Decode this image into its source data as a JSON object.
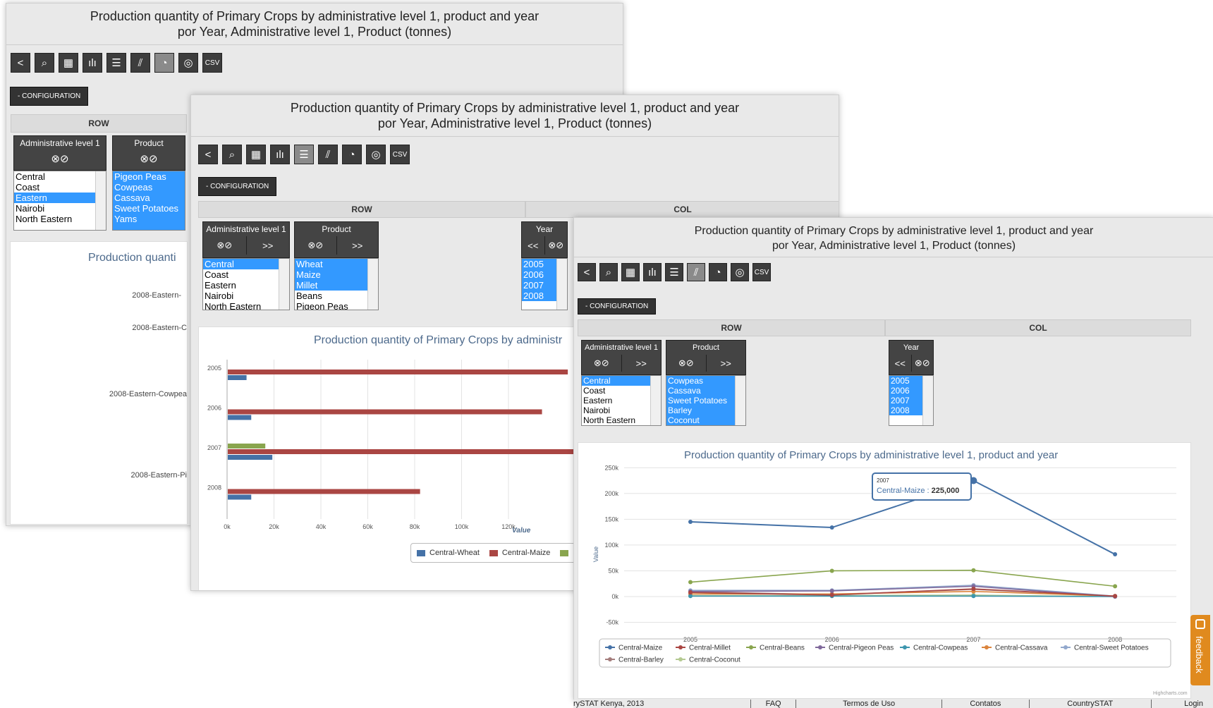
{
  "title_line1": "Production quantity of Primary Crops by administrative level 1, product and year",
  "title_line2": "por Year, Administrative level 1, Product (tonnes)",
  "toolbar": {
    "back": "<",
    "search": "⌕",
    "table": "▦",
    "bars": "ılı",
    "hbars": "☰",
    "line": "⫽",
    "pie": "◔",
    "globe": "◎",
    "csv": "CSV"
  },
  "config_label": "- CONFIGURATION",
  "row_label": "ROW",
  "col_label": "COL",
  "admin_header": "Administrative level 1",
  "product_header": "Product",
  "year_header": "Year",
  "ctrl_clear_check": "⊗⊘",
  "ctrl_move_right": ">>",
  "ctrl_move_left": "<<",
  "win1": {
    "admin_items": [
      {
        "label": "Central"
      },
      {
        "label": "Coast"
      },
      {
        "label": "Eastern"
      },
      {
        "label": "Nairobi"
      },
      {
        "label": "North Eastern"
      }
    ],
    "product_items": [
      "Pigeon Peas",
      "Cowpeas",
      "Cassava",
      "Sweet Potatoes",
      "Yams"
    ],
    "chart_title_partial": "Production quanti",
    "labels": [
      "2008-Eastern-",
      "2008-Eastern-C",
      "2008-Eastern-Cowpea",
      "2008-Eastern-Pi"
    ]
  },
  "win2": {
    "admin_items": [
      "Central",
      "Coast",
      "Eastern",
      "Nairobi",
      "North Eastern"
    ],
    "product_items": [
      "Wheat",
      "Maize",
      "Millet",
      "Beans",
      "Pigeon Peas"
    ],
    "year_items": [
      "2005",
      "2006",
      "2007",
      "2008"
    ],
    "chart_title_partial": "Production quantity of Primary Crops by administr",
    "xlabel": "Value",
    "legend": [
      "Central-Wheat",
      "Central-Maize"
    ]
  },
  "win3": {
    "admin_items": [
      "Central",
      "Coast",
      "Eastern",
      "Nairobi",
      "North Eastern"
    ],
    "product_items": [
      "Cowpeas",
      "Cassava",
      "Sweet Potatoes",
      "Barley",
      "Coconut"
    ],
    "year_items": [
      "2005",
      "2006",
      "2007",
      "2008"
    ],
    "chart_title": "Production quantity of Primary Crops by administrative level 1, product and year",
    "ylabel": "Value",
    "tooltip_year": "2007",
    "tooltip_series": "Central-Maize :",
    "tooltip_value": "225,000",
    "credit": "Highcharts.com"
  },
  "colors": {
    "maize": "#4572a7",
    "millet": "#aa4643",
    "beans": "#89a54e",
    "pigeon": "#80699b",
    "cowpeas": "#3d96ae",
    "cassava": "#db843d",
    "sweet": "#92a8cd",
    "barley": "#a47d7c",
    "coconut": "#b5ca92",
    "selection": "#3399ff"
  },
  "chart_data": [
    {
      "type": "bar",
      "title": "Production quantity of Primary Crops by administr",
      "categories": [
        "2005",
        "2006",
        "2007",
        "2008"
      ],
      "xlabel": "Value",
      "xlim": [
        0,
        140000
      ],
      "ticks": [
        "0k",
        "20k",
        "40k",
        "60k",
        "80k",
        "100k",
        "120k"
      ],
      "series": [
        {
          "name": "Central-Wheat",
          "values": [
            8000,
            10000,
            19000,
            10000
          ]
        },
        {
          "name": "Central-Maize",
          "values": [
            145000,
            134000,
            225000,
            82000
          ]
        },
        {
          "name": "",
          "values": [
            0,
            0,
            16000,
            0
          ]
        }
      ]
    },
    {
      "type": "line",
      "title": "Production quantity of Primary Crops by administrative level 1, product and year",
      "x": [
        "2005",
        "2006",
        "2007",
        "2008"
      ],
      "ylabel": "Value",
      "ylim": [
        -50000,
        250000
      ],
      "yticks": [
        "250k",
        "200k",
        "150k",
        "100k",
        "50k",
        "0k",
        "-50k"
      ],
      "series": [
        {
          "name": "Central-Maize",
          "values": [
            145000,
            134000,
            225000,
            82000
          ]
        },
        {
          "name": "Central-Millet",
          "values": [
            8000,
            3000,
            15000,
            1000
          ]
        },
        {
          "name": "Central-Beans",
          "values": [
            28000,
            50000,
            51000,
            20000
          ]
        },
        {
          "name": "Central-Pigeon Peas",
          "values": [
            10000,
            11000,
            20000,
            0
          ]
        },
        {
          "name": "Central-Cowpeas",
          "values": [
            1000,
            1000,
            1000,
            0
          ]
        },
        {
          "name": "Central-Cassava",
          "values": [
            5000,
            5000,
            10000,
            1000
          ]
        },
        {
          "name": "Central-Sweet Potatoes",
          "values": [
            12000,
            12000,
            22000,
            1000
          ]
        },
        {
          "name": "Central-Barley",
          "values": [
            9000,
            4000,
            14000,
            1000
          ]
        },
        {
          "name": "Central-Coconut",
          "values": [
            2000,
            2000,
            3000,
            0
          ]
        }
      ]
    }
  ],
  "footer": [
    "rySTAT Kenya, 2013",
    "FAQ",
    "Termos de Uso",
    "Contatos",
    "CountrySTAT",
    "Login"
  ],
  "feedback_label": "feedback"
}
